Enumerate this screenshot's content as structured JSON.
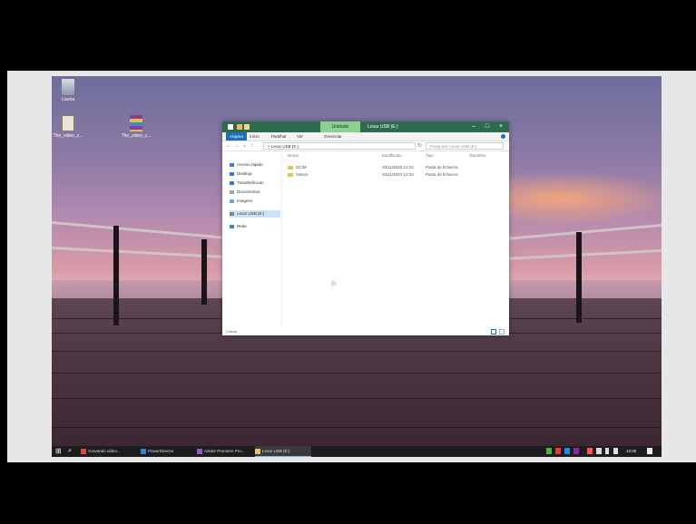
{
  "desktop": {
    "icons": [
      {
        "name": "recycle-bin-icon",
        "label": "Lixeira"
      },
      {
        "name": "video-file-icon",
        "label": "The_video_c..."
      },
      {
        "name": "archive-file-icon",
        "label": "The_video_c..."
      }
    ]
  },
  "explorer": {
    "context_tab": "Unidade",
    "title": "Lexar USB (E:)",
    "ribbon_tabs": [
      "Arquivo",
      "Início",
      "Partilhar",
      "Ver",
      "Gerenciar"
    ],
    "address": "> Lexar USB (E:)",
    "search_placeholder": "Pesquisar Lexar USB (E:)",
    "nav": [
      {
        "icon": "star-icon",
        "label": "Acesso rápido"
      },
      {
        "icon": "desktop-icon",
        "label": "Desktop"
      },
      {
        "icon": "download-icon",
        "label": "Transferências"
      },
      {
        "icon": "documents-icon",
        "label": "Documentos"
      },
      {
        "icon": "pictures-icon",
        "label": "Imagens"
      },
      {
        "icon": "drive-icon",
        "label": "Lexar USB (E:)"
      },
      {
        "icon": "network-icon",
        "label": "Rede"
      }
    ],
    "columns": [
      "Nome",
      "Modificado",
      "Tipo",
      "Tamanho"
    ],
    "files": [
      {
        "name": "DCIM",
        "modified": "20/11/2020 12:24",
        "type": "Pasta de ficheiros",
        "size": ""
      },
      {
        "name": "Videos",
        "modified": "20/11/2020 12:24",
        "type": "Pasta de ficheiros",
        "size": ""
      }
    ],
    "status": "2 itens"
  },
  "taskbar": {
    "apps": [
      {
        "label": "Gravando vídeo...",
        "color": "#e0463c"
      },
      {
        "label": "PowerDirector",
        "color": "#3b7bd8"
      },
      {
        "label": "Adobe Premiere Pro...",
        "color": "#8a5cc8"
      },
      {
        "label": "Lexar USB (E:)",
        "color": "#e8c15a"
      }
    ],
    "active_app": 3,
    "time": "12:00"
  }
}
